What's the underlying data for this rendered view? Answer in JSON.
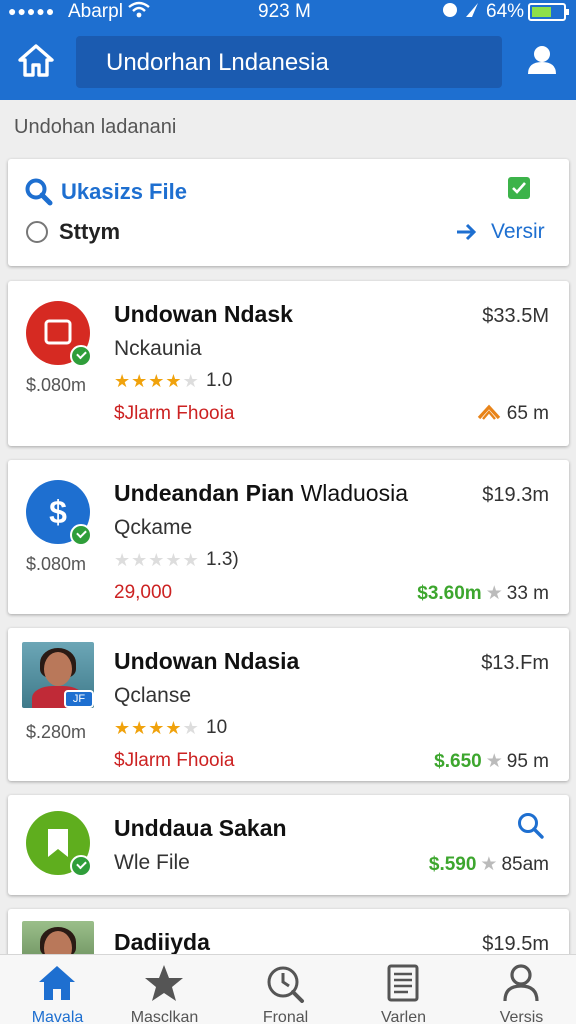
{
  "status_bar": {
    "carrier": "Abarpl",
    "time": "923 M",
    "battery": "64%",
    "battery_level": 0.64
  },
  "header": {
    "search_text": "Undorhan Lndanesia"
  },
  "section": {
    "title": "Undohan ladanani"
  },
  "filter_card": {
    "file_label": "Ukasizs File",
    "radio_label": "Sttym",
    "version_link": "Versir",
    "checkbox_checked": true,
    "radio_selected": false
  },
  "apps": [
    {
      "name": "Undowan Ndask",
      "name_extra": "",
      "subtitle": "Nckaunia",
      "price": "$33.5M",
      "size": "$.080m",
      "stars": 4,
      "rating": "1.0",
      "tag": "$Jlarm Fhooia",
      "meta_green": "",
      "meta_value": "65 m",
      "icon": "red-square-app-icon",
      "icon_color": "#d62a22"
    },
    {
      "name": "Undeandan Pian",
      "name_extra": "Wladuosia",
      "subtitle": "Qckame",
      "price": "$19.3m",
      "size": "$.080m",
      "stars": 0,
      "rating": "1.3)",
      "tag": "29,000",
      "meta_green": "$3.60m",
      "meta_value": "33 m",
      "icon": "dollar-app-icon",
      "icon_color": "#1e6fd0"
    },
    {
      "name": "Undowan Ndasia",
      "name_extra": "",
      "subtitle": "Qclanse",
      "price": "$13.Fm",
      "size": "$.280m",
      "stars": 4,
      "rating": "10",
      "tag": "$Jlarm Fhooia",
      "meta_green": "$.650",
      "meta_value": "95 m",
      "icon": "portrait-photo",
      "photo_badge": "JF"
    },
    {
      "name": "Unddaua Sakan",
      "name_extra": "",
      "subtitle": "Wle File",
      "price": "",
      "size": "",
      "meta_green": "$.590",
      "meta_value": "85am",
      "icon": "bookmark-app-icon",
      "icon_color": "#5fae1e"
    },
    {
      "name": "Dadiiyda",
      "name_extra": "",
      "price": "$19.5m",
      "icon": "portrait-photo"
    }
  ],
  "tabs": [
    {
      "label": "Mavala",
      "icon": "home-icon",
      "active": true
    },
    {
      "label": "Masclkan",
      "icon": "star-icon",
      "active": false
    },
    {
      "label": "Fronal",
      "icon": "clock-search-icon",
      "active": false
    },
    {
      "label": "Varlen",
      "icon": "document-icon",
      "active": false
    },
    {
      "label": "Versis",
      "icon": "user-icon",
      "active": false
    }
  ],
  "colors": {
    "primary": "#1e6fd0",
    "header_field": "#1b5bb0",
    "green": "#3da62e",
    "red_text": "#cc2222",
    "star": "#f0a20c"
  }
}
